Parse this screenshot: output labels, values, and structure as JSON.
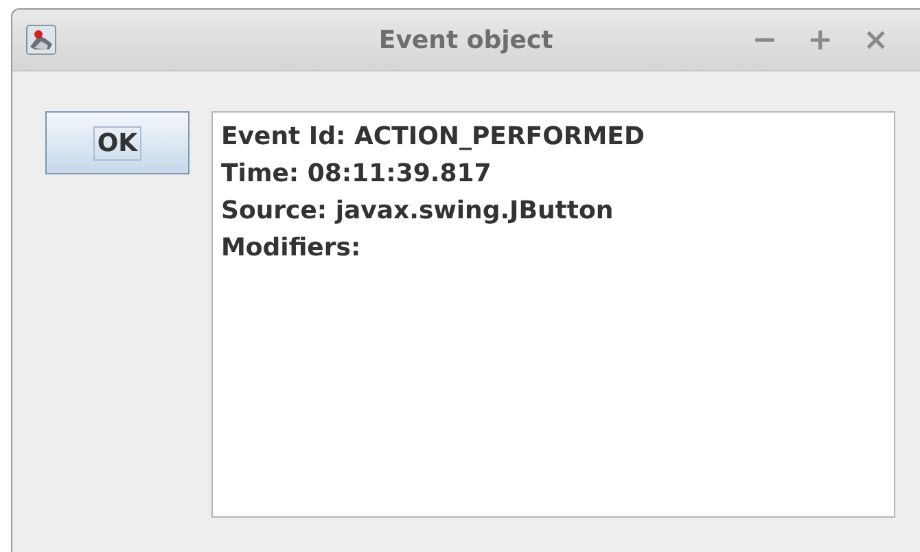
{
  "window": {
    "title": "Event object",
    "controls": [
      "−",
      "+",
      "×"
    ]
  },
  "button": {
    "label": "OK",
    "focused": true
  },
  "text_area": {
    "lines": [
      "Event Id: ACTION_PERFORMED",
      "Time: 08:11:39.817",
      "Source: javax.swing.JButton",
      "Modifiers:"
    ]
  }
}
